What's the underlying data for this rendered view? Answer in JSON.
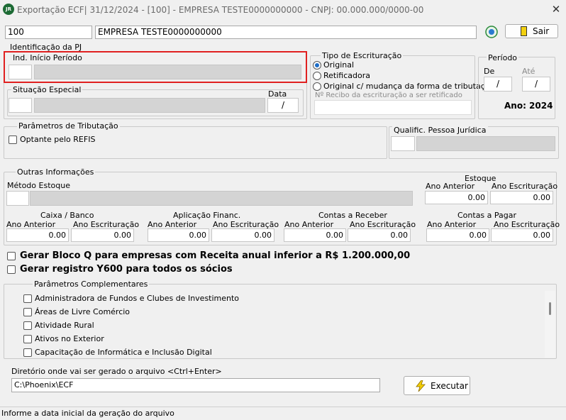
{
  "window": {
    "title": "Exportação ECF| 31/12/2024 - [100] - EMPRESA TESTE0000000000 - CNPJ: 00.000.000/0000-00",
    "close_glyph": "✕"
  },
  "empresa": {
    "codigo": "100",
    "nome": "EMPRESA TESTE0000000000",
    "sair_label": "Sair"
  },
  "identificacao": {
    "legend": "Identificação da PJ",
    "ind_inicio_label": "Ind. Início Período",
    "situacao_label": "Situação Especial",
    "data_label": "Data",
    "data_value": "/"
  },
  "tipo_escrituracao": {
    "legend": "Tipo de Escrituração",
    "options": [
      "Original",
      "Retificadora",
      "Original c/ mudança da forma de tributação"
    ],
    "selected": "Original",
    "recibo_placeholder": "Nº Recibo da escrituração a ser retificado"
  },
  "periodo": {
    "legend": "Período",
    "de_label": "De",
    "ate_label": "Até",
    "de_value": "/",
    "ate_value": "/",
    "ano_text": "Ano: 2024"
  },
  "tributacao": {
    "legend": "Parâmetros de Tributação",
    "refis_label": "Optante pelo REFIS",
    "qualific_label": "Qualific. Pessoa Jurídica"
  },
  "outras": {
    "legend": "Outras Informações",
    "metodo_label": "Método Estoque",
    "estoque": {
      "title": "Estoque",
      "anterior_label": "Ano Anterior",
      "escrit_label": "Ano Escrituração",
      "anterior": "0.00",
      "escrit": "0.00"
    },
    "caixa": {
      "title": "Caixa / Banco",
      "anterior_label": "Ano  Anterior",
      "escrit_label": "Ano Escrituração",
      "anterior": "0.00",
      "escrit": "0.00"
    },
    "aplicacao": {
      "title": "Aplicação Financ.",
      "anterior_label": "Ano  Anterior",
      "escrit_label": "Ano Escrituração",
      "anterior": "0.00",
      "escrit": "0.00"
    },
    "receber": {
      "title": "Contas a Receber",
      "anterior_label": "Ano Anterior",
      "escrit_label": "Ano Escrituração",
      "anterior": "0.00",
      "escrit": "0.00"
    },
    "pagar": {
      "title": "Contas a Pagar",
      "anterior_label": "Ano Anterior",
      "escrit_label": "Ano Escrituração",
      "anterior": "0.00",
      "escrit": "0.00"
    }
  },
  "bloco_q_label": "Gerar Bloco Q para empresas com Receita anual inferior a R$ 1.200.000,00",
  "y600_label": "Gerar registro Y600 para todos os sócios",
  "complementares": {
    "legend": "Parâmetros Complementares",
    "items": [
      "Administradora de Fundos e Clubes de Investimento",
      "Áreas de Livre Comércio",
      "Atividade Rural",
      "Ativos no Exterior",
      "Capacitação de Informática e Inclusão Digital"
    ]
  },
  "diretorio": {
    "label": "Diretório onde vai ser gerado o arquivo <Ctrl+Enter>",
    "value": "C:\\Phoenix\\ECF"
  },
  "executar_label": "Executar",
  "status_text": "Informe a data inicial da geração do arquivo",
  "colors": {
    "highlight": "#e02020",
    "radio_selected": "#1e6ec8",
    "logo": "#1d6b35"
  }
}
